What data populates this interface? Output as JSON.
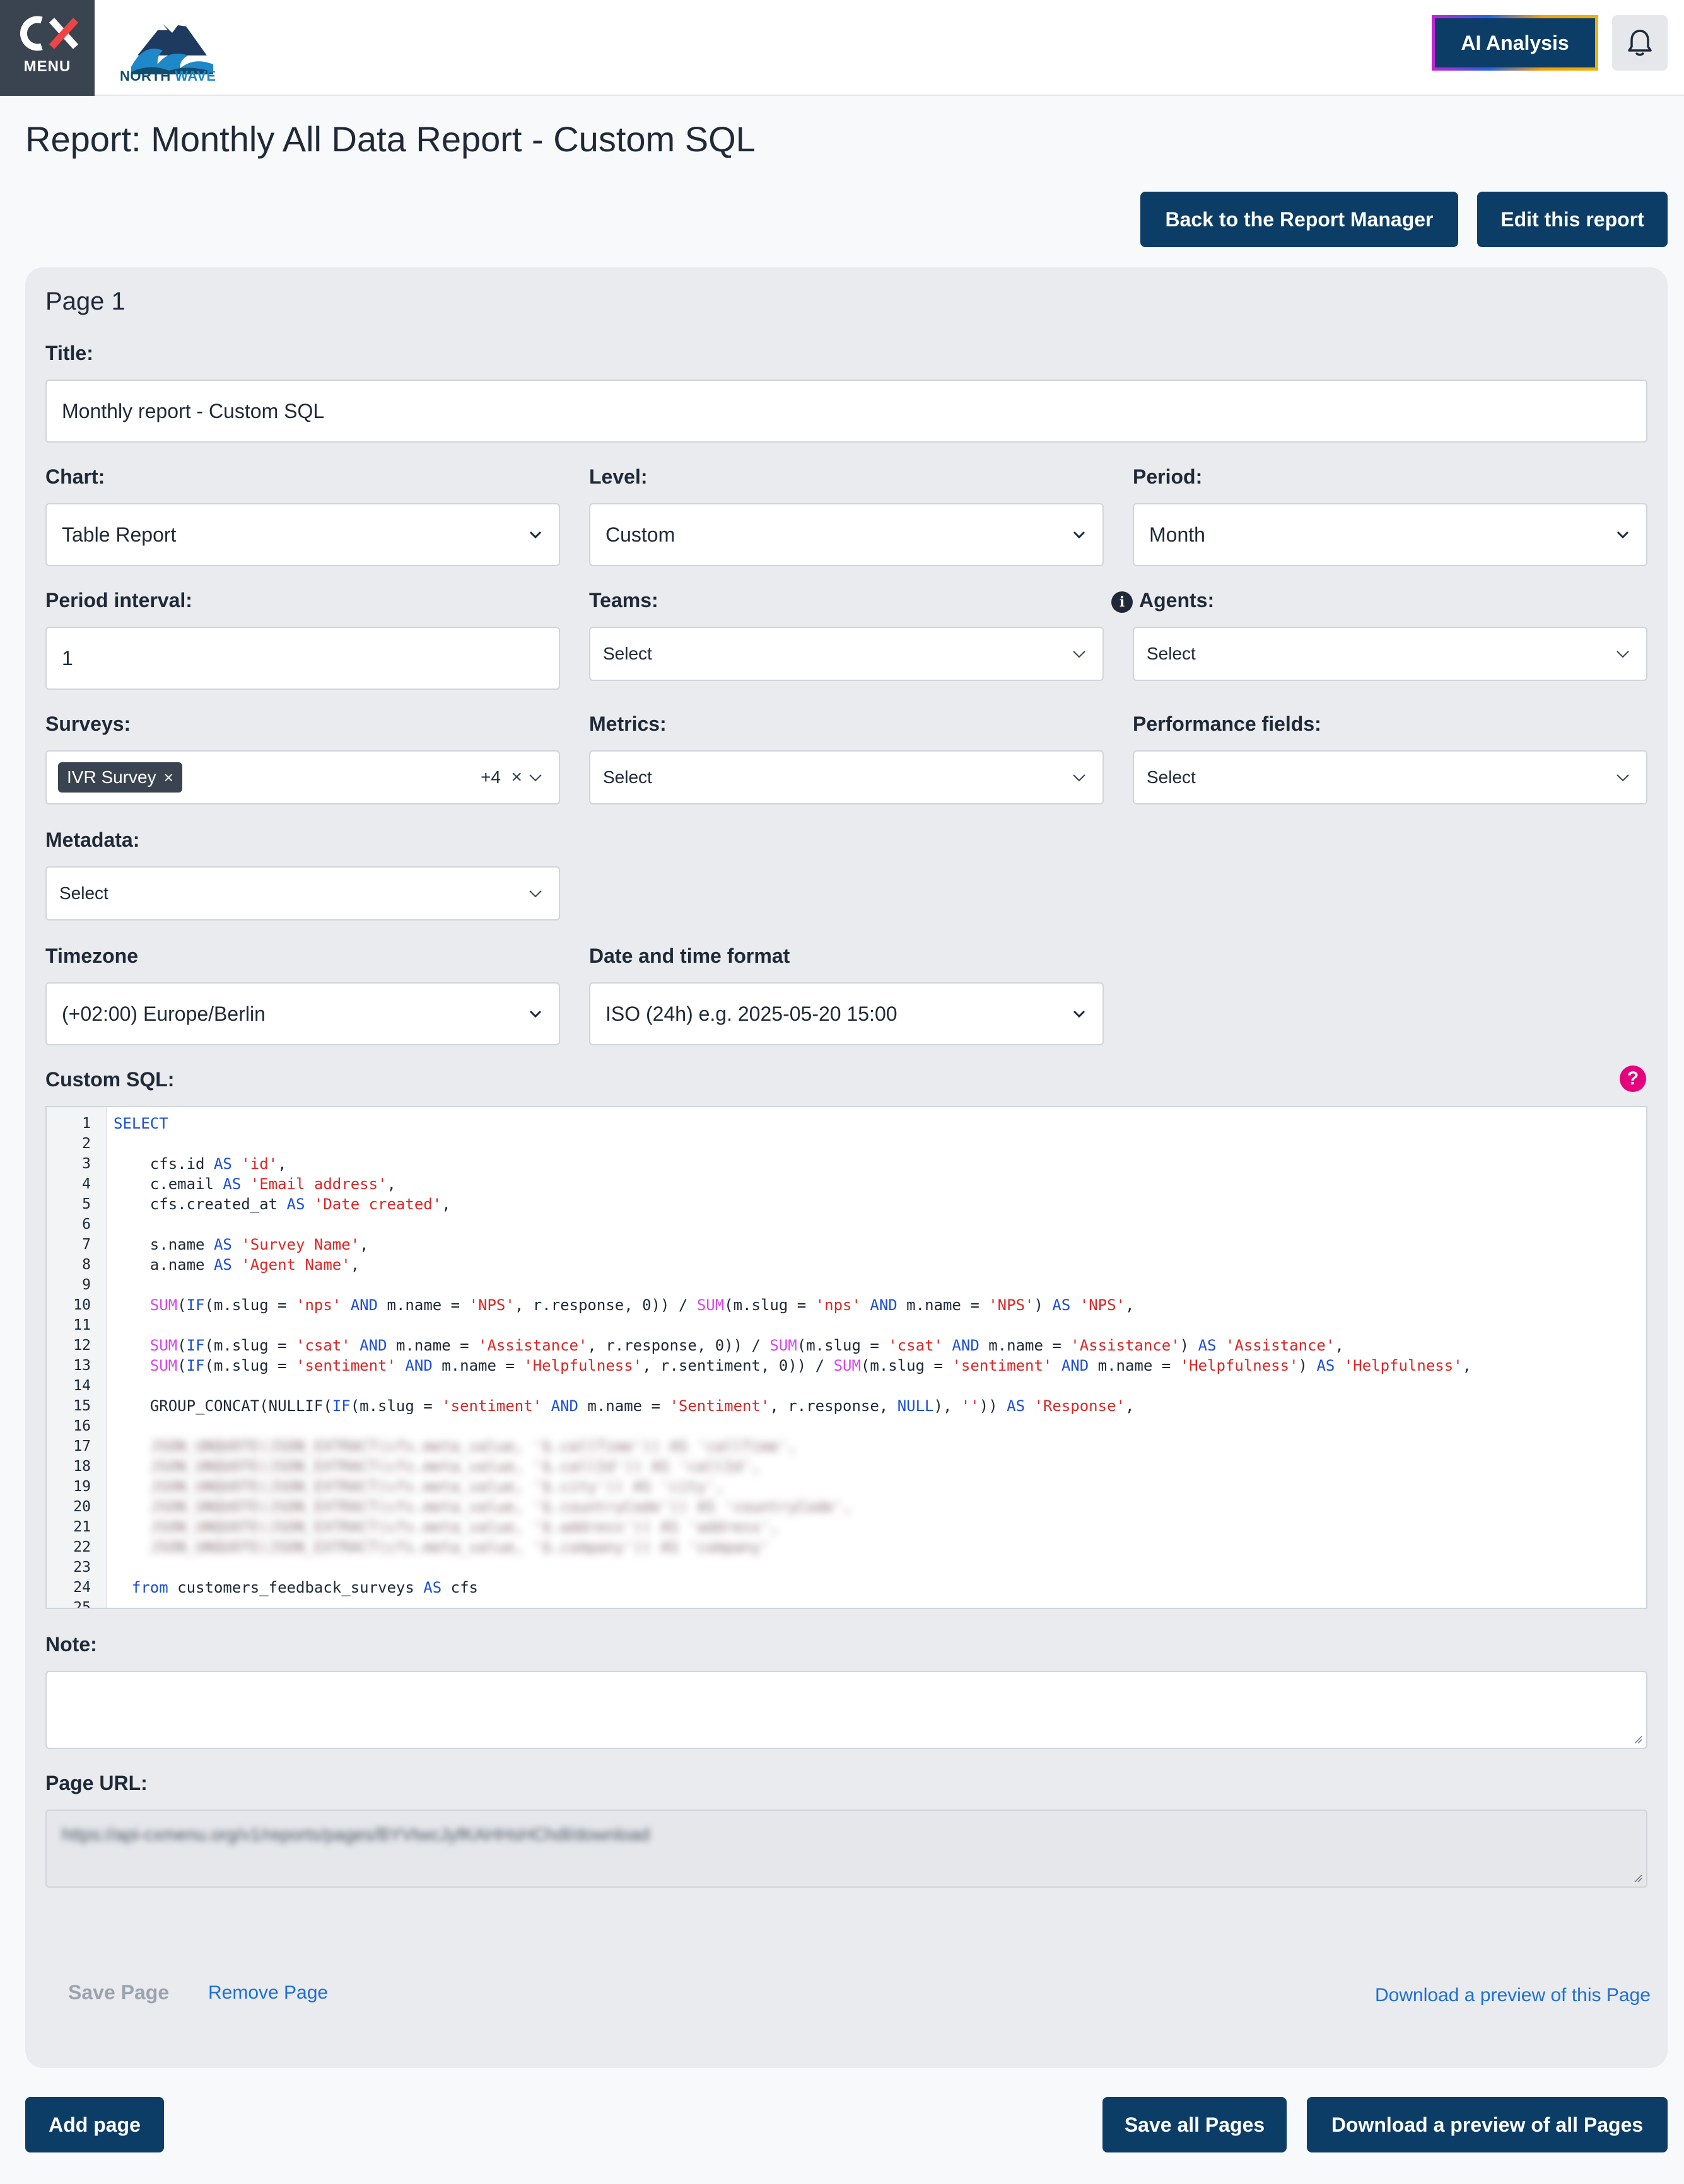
{
  "header": {
    "menu_logo": "CX",
    "menu_label": "MENU",
    "brand_name_a": "NORTH",
    "brand_name_b": "WAVE",
    "ai_button": "AI Analysis"
  },
  "page_title": "Report: Monthly All Data Report - Custom SQL",
  "actions": {
    "back": "Back to the Report Manager",
    "edit": "Edit this report"
  },
  "page": {
    "heading": "Page 1",
    "title_label": "Title:",
    "title_value": "Monthly report - Custom SQL",
    "chart_label": "Chart:",
    "chart_value": "Table Report",
    "level_label": "Level:",
    "level_value": "Custom",
    "period_label": "Period:",
    "period_value": "Month",
    "period_interval_label": "Period interval:",
    "period_interval_value": "1",
    "teams_label": "Teams:",
    "teams_value": "Select",
    "agents_label": "Agents:",
    "agents_value": "Select",
    "surveys_label": "Surveys:",
    "surveys_tag": "IVR Survey",
    "surveys_more": "+4",
    "metrics_label": "Metrics:",
    "metrics_value": "Select",
    "performance_label": "Performance fields:",
    "performance_value": "Select",
    "metadata_label": "Metadata:",
    "metadata_value": "Select",
    "timezone_label": "Timezone",
    "timezone_value": "(+02:00) Europe/Berlin",
    "datetime_label": "Date and time format",
    "datetime_value": "ISO (24h) e.g. 2025-05-20 15:00",
    "sql_label": "Custom SQL:",
    "note_label": "Note:",
    "note_value": "",
    "url_label": "Page URL:",
    "url_value": "https://api-cxmenu.org/v1/reports/pages/BYVtwcJyfKAHHsHChdl/download",
    "save_page": "Save Page",
    "remove_page": "Remove Page",
    "download_page": "Download a preview of this Page"
  },
  "sql_lines": [
    {
      "n": "1",
      "segs": [
        {
          "c": "kw",
          "t": "SELECT"
        }
      ]
    },
    {
      "n": "2",
      "segs": []
    },
    {
      "n": "3",
      "segs": [
        {
          "c": "",
          "t": "    cfs.id "
        },
        {
          "c": "kw",
          "t": "AS"
        },
        {
          "c": "",
          "t": " "
        },
        {
          "c": "st",
          "t": "'id'"
        },
        {
          "c": "",
          "t": ","
        }
      ]
    },
    {
      "n": "4",
      "segs": [
        {
          "c": "",
          "t": "    c.email "
        },
        {
          "c": "kw",
          "t": "AS"
        },
        {
          "c": "",
          "t": " "
        },
        {
          "c": "st",
          "t": "'Email address'"
        },
        {
          "c": "",
          "t": ","
        }
      ]
    },
    {
      "n": "5",
      "segs": [
        {
          "c": "",
          "t": "    cfs.created_at "
        },
        {
          "c": "kw",
          "t": "AS"
        },
        {
          "c": "",
          "t": " "
        },
        {
          "c": "st",
          "t": "'Date created'"
        },
        {
          "c": "",
          "t": ","
        }
      ]
    },
    {
      "n": "6",
      "segs": []
    },
    {
      "n": "7",
      "segs": [
        {
          "c": "",
          "t": "    s.name "
        },
        {
          "c": "kw",
          "t": "AS"
        },
        {
          "c": "",
          "t": " "
        },
        {
          "c": "st",
          "t": "'Survey Name'"
        },
        {
          "c": "",
          "t": ","
        }
      ]
    },
    {
      "n": "8",
      "segs": [
        {
          "c": "",
          "t": "    a.name "
        },
        {
          "c": "kw",
          "t": "AS"
        },
        {
          "c": "",
          "t": " "
        },
        {
          "c": "st",
          "t": "'Agent Name'"
        },
        {
          "c": "",
          "t": ","
        }
      ]
    },
    {
      "n": "9",
      "segs": []
    },
    {
      "n": "10",
      "segs": [
        {
          "c": "",
          "t": "    "
        },
        {
          "c": "fn",
          "t": "SUM"
        },
        {
          "c": "",
          "t": "("
        },
        {
          "c": "kw",
          "t": "IF"
        },
        {
          "c": "",
          "t": "(m.slug = "
        },
        {
          "c": "st",
          "t": "'nps'"
        },
        {
          "c": "",
          "t": " "
        },
        {
          "c": "kw",
          "t": "AND"
        },
        {
          "c": "",
          "t": " m.name = "
        },
        {
          "c": "st",
          "t": "'NPS'"
        },
        {
          "c": "",
          "t": ", r.response, 0)) / "
        },
        {
          "c": "fn",
          "t": "SUM"
        },
        {
          "c": "",
          "t": "(m.slug = "
        },
        {
          "c": "st",
          "t": "'nps'"
        },
        {
          "c": "",
          "t": " "
        },
        {
          "c": "kw",
          "t": "AND"
        },
        {
          "c": "",
          "t": " m.name = "
        },
        {
          "c": "st",
          "t": "'NPS'"
        },
        {
          "c": "",
          "t": ") "
        },
        {
          "c": "kw",
          "t": "AS"
        },
        {
          "c": "",
          "t": " "
        },
        {
          "c": "st",
          "t": "'NPS'"
        },
        {
          "c": "",
          "t": ","
        }
      ]
    },
    {
      "n": "11",
      "segs": []
    },
    {
      "n": "12",
      "segs": [
        {
          "c": "",
          "t": "    "
        },
        {
          "c": "fn",
          "t": "SUM"
        },
        {
          "c": "",
          "t": "("
        },
        {
          "c": "kw",
          "t": "IF"
        },
        {
          "c": "",
          "t": "(m.slug = "
        },
        {
          "c": "st",
          "t": "'csat'"
        },
        {
          "c": "",
          "t": " "
        },
        {
          "c": "kw",
          "t": "AND"
        },
        {
          "c": "",
          "t": " m.name = "
        },
        {
          "c": "st",
          "t": "'Assistance'"
        },
        {
          "c": "",
          "t": ", r.response, 0)) / "
        },
        {
          "c": "fn",
          "t": "SUM"
        },
        {
          "c": "",
          "t": "(m.slug = "
        },
        {
          "c": "st",
          "t": "'csat'"
        },
        {
          "c": "",
          "t": " "
        },
        {
          "c": "kw",
          "t": "AND"
        },
        {
          "c": "",
          "t": " m.name = "
        },
        {
          "c": "st",
          "t": "'Assistance'"
        },
        {
          "c": "",
          "t": ") "
        },
        {
          "c": "kw",
          "t": "AS"
        },
        {
          "c": "",
          "t": " "
        },
        {
          "c": "st",
          "t": "'Assistance'"
        },
        {
          "c": "",
          "t": ","
        }
      ]
    },
    {
      "n": "13",
      "segs": [
        {
          "c": "",
          "t": "    "
        },
        {
          "c": "fn",
          "t": "SUM"
        },
        {
          "c": "",
          "t": "("
        },
        {
          "c": "kw",
          "t": "IF"
        },
        {
          "c": "",
          "t": "(m.slug = "
        },
        {
          "c": "st",
          "t": "'sentiment'"
        },
        {
          "c": "",
          "t": " "
        },
        {
          "c": "kw",
          "t": "AND"
        },
        {
          "c": "",
          "t": " m.name = "
        },
        {
          "c": "st",
          "t": "'Helpfulness'"
        },
        {
          "c": "",
          "t": ", r.sentiment, 0)) / "
        },
        {
          "c": "fn",
          "t": "SUM"
        },
        {
          "c": "",
          "t": "(m.slug = "
        },
        {
          "c": "st",
          "t": "'sentiment'"
        },
        {
          "c": "",
          "t": " "
        },
        {
          "c": "kw",
          "t": "AND"
        },
        {
          "c": "",
          "t": " m.name = "
        },
        {
          "c": "st",
          "t": "'Helpfulness'"
        },
        {
          "c": "",
          "t": ") "
        },
        {
          "c": "kw",
          "t": "AS"
        },
        {
          "c": "",
          "t": " "
        },
        {
          "c": "st",
          "t": "'Helpfulness'"
        },
        {
          "c": "",
          "t": ","
        }
      ]
    },
    {
      "n": "14",
      "segs": []
    },
    {
      "n": "15",
      "segs": [
        {
          "c": "",
          "t": "    GROUP_CONCAT(NULLIF("
        },
        {
          "c": "kw",
          "t": "IF"
        },
        {
          "c": "",
          "t": "(m.slug = "
        },
        {
          "c": "st",
          "t": "'sentiment'"
        },
        {
          "c": "",
          "t": " "
        },
        {
          "c": "kw",
          "t": "AND"
        },
        {
          "c": "",
          "t": " m.name = "
        },
        {
          "c": "st",
          "t": "'Sentiment'"
        },
        {
          "c": "",
          "t": ", r.response, "
        },
        {
          "c": "kw",
          "t": "NULL"
        },
        {
          "c": "",
          "t": "), "
        },
        {
          "c": "st",
          "t": "''"
        },
        {
          "c": "",
          "t": ")) "
        },
        {
          "c": "kw",
          "t": "AS"
        },
        {
          "c": "",
          "t": " "
        },
        {
          "c": "st",
          "t": "'Response'"
        },
        {
          "c": "",
          "t": ","
        }
      ]
    },
    {
      "n": "16",
      "segs": []
    },
    {
      "n": "17",
      "segs": [
        {
          "c": "blur",
          "t": "    JSON_UNQUOTE(JSON_EXTRACT(cfs.meta_value, '$.callTime')) AS 'callTime',"
        }
      ]
    },
    {
      "n": "18",
      "segs": [
        {
          "c": "blur",
          "t": "    JSON_UNQUOTE(JSON_EXTRACT(cfs.meta_value, '$.callId')) AS 'callId',"
        }
      ]
    },
    {
      "n": "19",
      "segs": [
        {
          "c": "blur",
          "t": "    JSON_UNQUOTE(JSON_EXTRACT(cfs.meta_value, '$.city')) AS 'city',"
        }
      ]
    },
    {
      "n": "20",
      "segs": [
        {
          "c": "blur",
          "t": "    JSON_UNQUOTE(JSON_EXTRACT(cfs.meta_value, '$.countryCode')) AS 'countryCode',"
        }
      ]
    },
    {
      "n": "21",
      "segs": [
        {
          "c": "blur",
          "t": "    JSON_UNQUOTE(JSON_EXTRACT(cfs.meta_value, '$.address')) AS 'address',"
        }
      ]
    },
    {
      "n": "22",
      "segs": [
        {
          "c": "blur",
          "t": "    JSON_UNQUOTE(JSON_EXTRACT(cfs.meta_value, '$.company')) AS 'company'"
        }
      ]
    },
    {
      "n": "23",
      "segs": []
    },
    {
      "n": "24",
      "segs": [
        {
          "c": "",
          "t": "  "
        },
        {
          "c": "kw",
          "t": "from"
        },
        {
          "c": "",
          "t": " customers_feedback_surveys "
        },
        {
          "c": "kw",
          "t": "AS"
        },
        {
          "c": "",
          "t": " cfs"
        }
      ]
    },
    {
      "n": "25",
      "segs": []
    }
  ],
  "footer": {
    "add_page": "Add page",
    "save_all": "Save all Pages",
    "download_all": "Download a preview of all Pages"
  },
  "colors": {
    "primary": "#0b3d66",
    "help": "#e6007e",
    "link": "#1d6fd8"
  }
}
